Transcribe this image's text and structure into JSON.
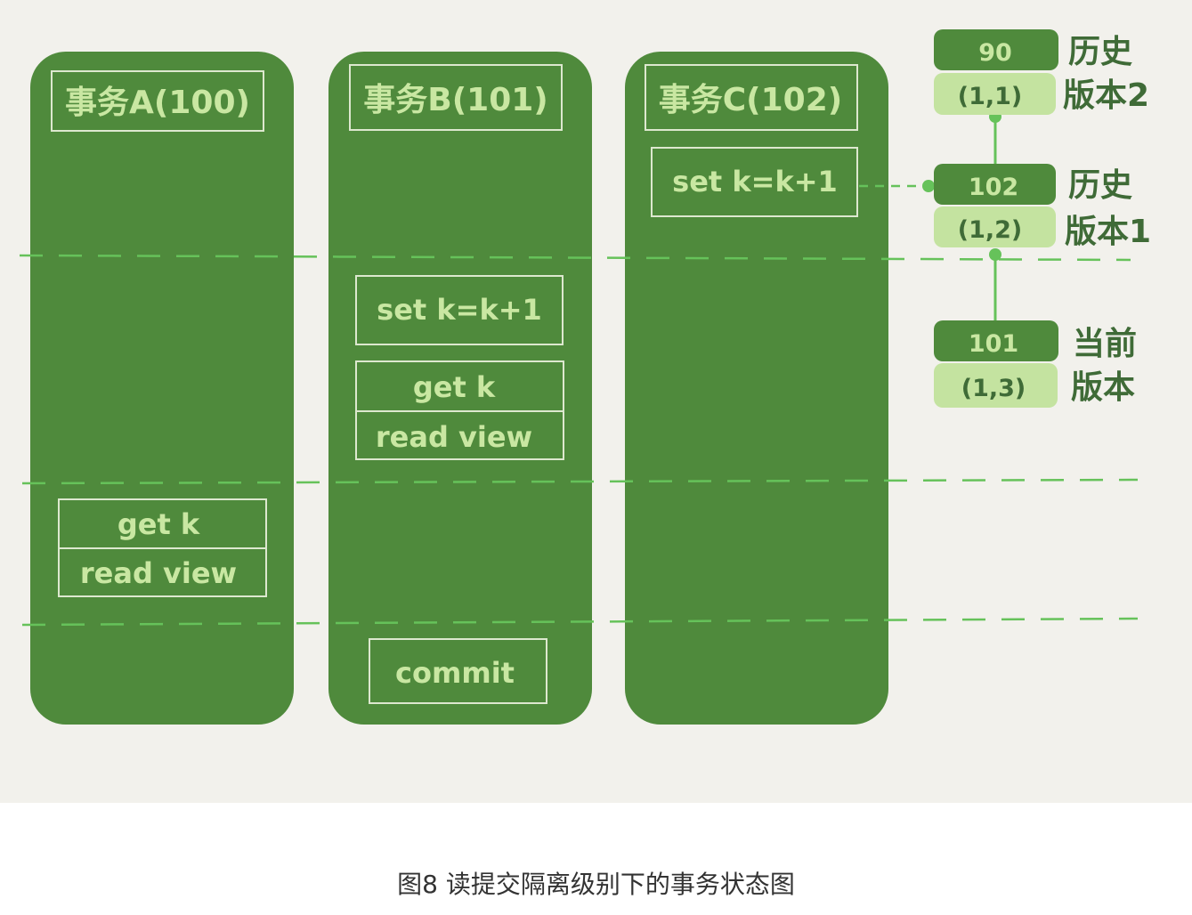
{
  "transactions": [
    {
      "title": "事务A(100)",
      "ops": [
        "get k",
        "read view"
      ]
    },
    {
      "title": "事务B(101)",
      "ops": [
        "set k=k+1",
        "get k",
        "read view",
        "commit"
      ]
    },
    {
      "title": "事务C(102)",
      "ops": [
        "set k=k+1"
      ]
    }
  ],
  "versions": [
    {
      "trx_id": "90",
      "row": "(1,1)",
      "label_top": "历史",
      "label_bottom": "版本2"
    },
    {
      "trx_id": "102",
      "row": "(1,2)",
      "label_top": "历史",
      "label_bottom": "版本1"
    },
    {
      "trx_id": "101",
      "row": "(1,3)",
      "label_top": "当前",
      "label_bottom": "版本"
    }
  ],
  "caption": "图8 读提交隔离级别下的事务状态图",
  "colors": {
    "column": "#4f8a3c",
    "column_light_text": "#c9e7a2",
    "version_dark": "#4f8a3c",
    "version_light": "#c4e3a0",
    "dash_line": "#66c25a",
    "background": "#f2f1ec"
  }
}
